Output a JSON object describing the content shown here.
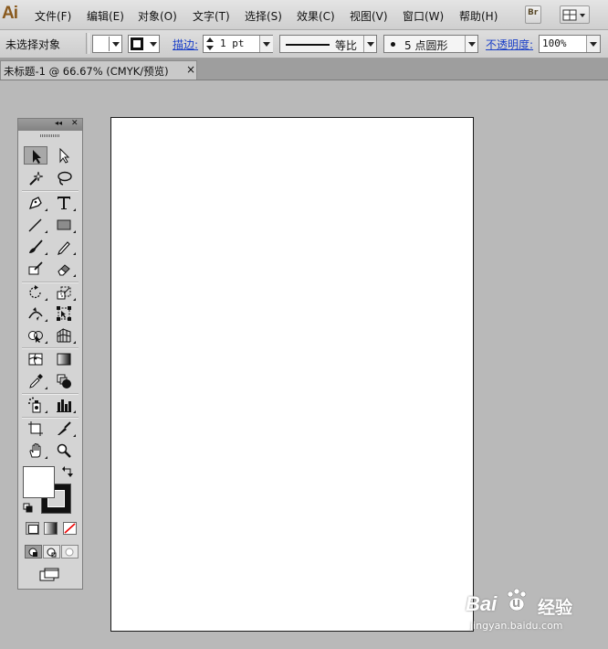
{
  "app": {
    "logo_text": "Ai"
  },
  "menu": {
    "items": [
      {
        "label": "文件(F)"
      },
      {
        "label": "编辑(E)"
      },
      {
        "label": "对象(O)"
      },
      {
        "label": "文字(T)"
      },
      {
        "label": "选择(S)"
      },
      {
        "label": "效果(C)"
      },
      {
        "label": "视图(V)"
      },
      {
        "label": "窗口(W)"
      },
      {
        "label": "帮助(H)"
      }
    ],
    "bridge_label": "Br"
  },
  "control_bar": {
    "selection_status": "未选择对象",
    "stroke_label": "描边:",
    "stroke_weight": "1 pt",
    "stroke_profile": "等比",
    "brush": "5 点圆形",
    "opacity_label": "不透明度:",
    "opacity_value": "100%"
  },
  "document_tab": {
    "title": "未标题-1 @ 66.67% (CMYK/预览)",
    "close": "×"
  },
  "tools_panel": {
    "collapse_glyph": "◂◂",
    "close_glyph": "✕"
  },
  "watermark": {
    "brand_latin1": "Bai",
    "brand_latin2": "u",
    "brand_cn": "经验",
    "url": "jingyan.baidu.com"
  },
  "colors": {
    "menubar": "#d8d8d8",
    "workspace": "#b9b9b9",
    "link": "#1a3fc8",
    "logo": "#8a5a1e"
  }
}
